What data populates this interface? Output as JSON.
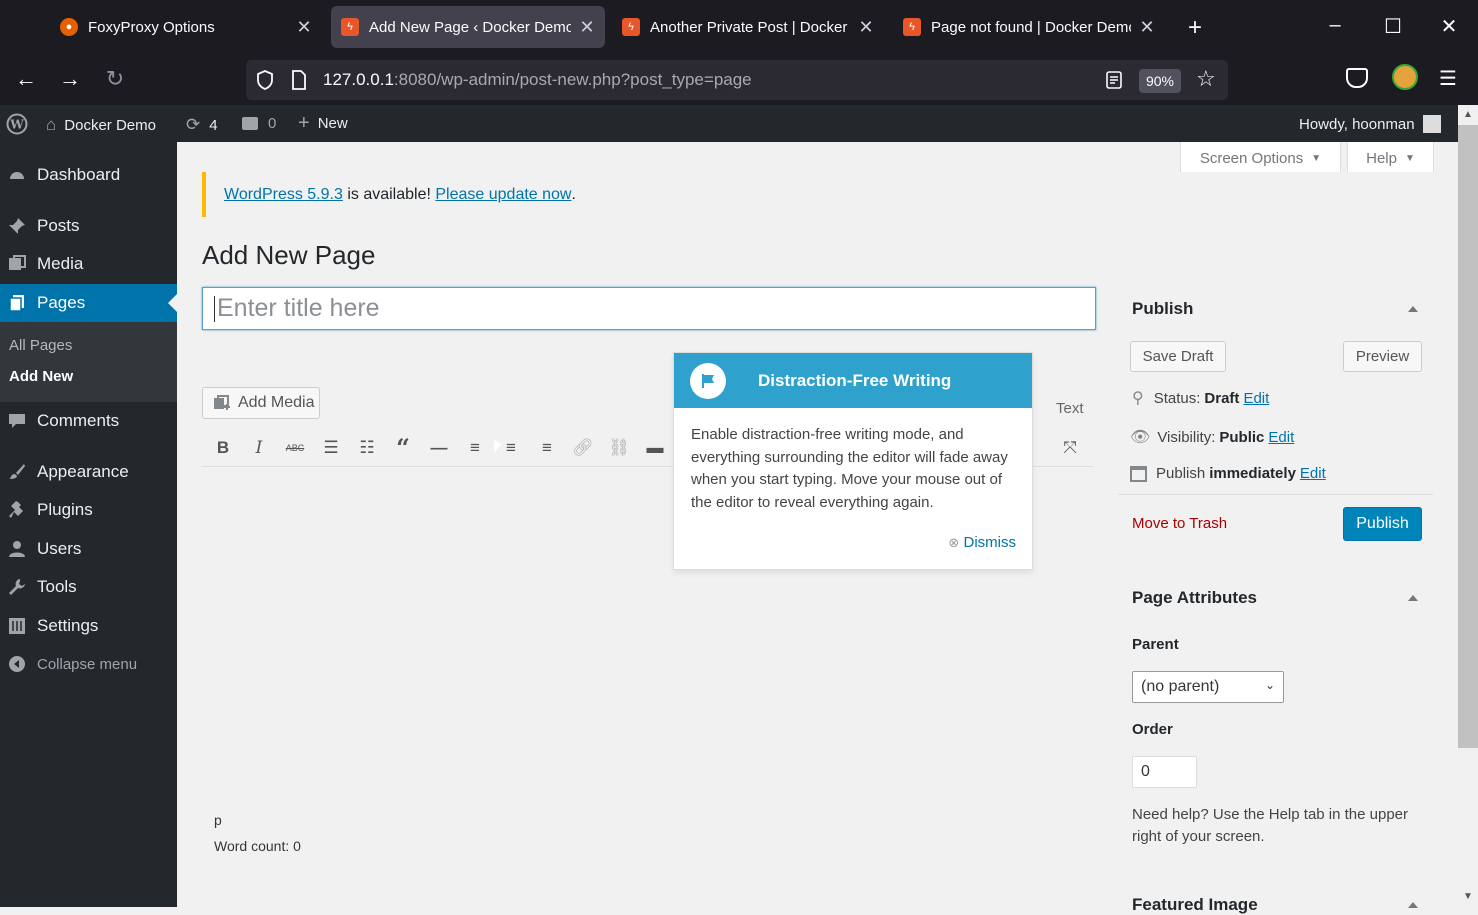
{
  "browser": {
    "tabs": [
      {
        "title": "FoxyProxy Options",
        "active": false
      },
      {
        "title": "Add New Page ‹ Docker Demo",
        "active": true
      },
      {
        "title": "Another Private Post | Docker D",
        "active": false
      },
      {
        "title": "Page not found | Docker Demo",
        "active": false
      }
    ],
    "url_host": "127.0.0.1",
    "url_rest": ":8080/wp-admin/post-new.php?post_type=page",
    "zoom": "90%",
    "accent": "#0073aa"
  },
  "adminbar": {
    "site": "Docker Demo",
    "updates": "4",
    "comments": "0",
    "new": "New",
    "howdy": "Howdy, hoonman"
  },
  "menu": {
    "dashboard": "Dashboard",
    "posts": "Posts",
    "media": "Media",
    "pages": "Pages",
    "all_pages": "All Pages",
    "add_new": "Add New",
    "comments": "Comments",
    "appearance": "Appearance",
    "plugins": "Plugins",
    "users": "Users",
    "tools": "Tools",
    "settings": "Settings",
    "collapse": "Collapse menu"
  },
  "topbar": {
    "screen_options": "Screen Options",
    "help": "Help"
  },
  "notice": {
    "link1": "WordPress 5.9.3",
    "text": " is available! ",
    "link2": "Please update now",
    "end": "."
  },
  "page": {
    "heading": "Add New Page",
    "title_placeholder": "Enter title here"
  },
  "editor": {
    "add_media": "Add Media",
    "text_tab": "Text",
    "path": "p",
    "word_count": "Word count: 0"
  },
  "pointer": {
    "title": "Distraction-Free Writing",
    "body": "Enable distraction-free writing mode, and everything surrounding the editor will fade away when you start typing. Move your mouse out of the editor to reveal everything again.",
    "dismiss": "Dismiss"
  },
  "publish": {
    "title": "Publish",
    "save_draft": "Save Draft",
    "preview": "Preview",
    "status_label": "Status:",
    "status_value": "Draft",
    "visibility_label": "Visibility:",
    "visibility_value": "Public",
    "publish_label": "Publish",
    "publish_value": "immediately",
    "edit": "Edit",
    "trash": "Move to Trash",
    "publish_btn": "Publish"
  },
  "attributes": {
    "title": "Page Attributes",
    "parent_label": "Parent",
    "parent_value": "(no parent)",
    "order_label": "Order",
    "order_value": "0",
    "help": "Need help? Use the Help tab in the upper right of your screen."
  },
  "featured": {
    "title": "Featured Image"
  }
}
